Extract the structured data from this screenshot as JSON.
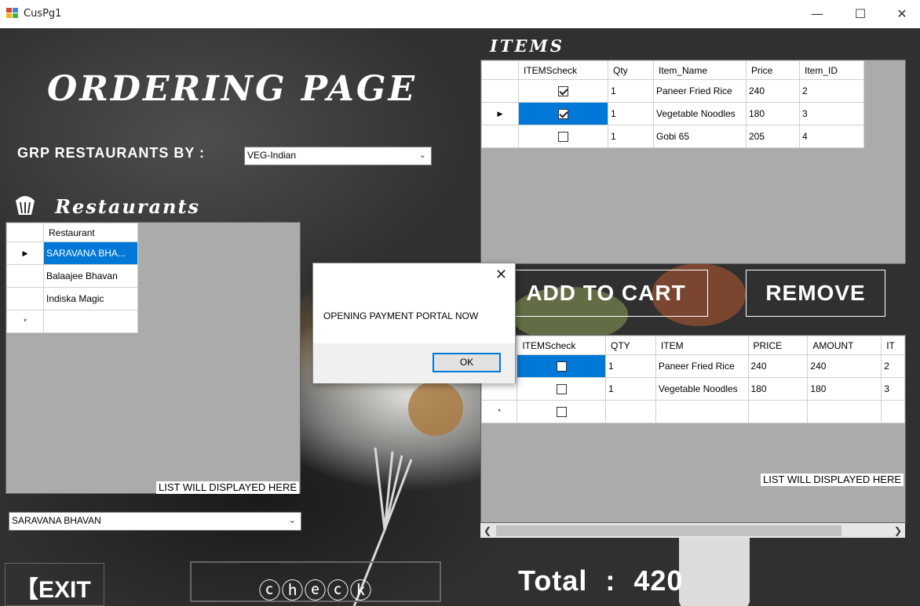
{
  "window": {
    "title": "CusPg1",
    "minimize": "—",
    "maximize": "☐",
    "close": "✕"
  },
  "headings": {
    "ordering": "ORDERING PAGE",
    "items": "ITEMS",
    "restaurants": "Restaurants"
  },
  "group_by": {
    "label": "GRP RESTAURANTS BY :",
    "value": "VEG-Indian"
  },
  "restaurant_grid": {
    "header": "Restaurant",
    "rows": [
      "SARAVANA BHA...",
      "Balaajee Bhavan",
      "Indiska Magic",
      ""
    ],
    "new_row_marker": "*",
    "list_label": "LIST WILL DISPLAYED HERE"
  },
  "restaurant_select": {
    "value": "SARAVANA BHAVAN"
  },
  "items_grid": {
    "headers": [
      "ITEMScheck",
      "Qty",
      "Item_Name",
      "Price",
      "Item_ID"
    ],
    "rows": [
      {
        "checked": true,
        "qty": "1",
        "name": "Paneer Fried Rice",
        "price": "240",
        "id": "2"
      },
      {
        "checked": true,
        "qty": "1",
        "name": "Vegetable Noodles",
        "price": "180",
        "id": "3"
      },
      {
        "checked": false,
        "qty": "1",
        "name": "Gobi 65",
        "price": "205",
        "id": "4"
      }
    ]
  },
  "buttons": {
    "add_to_cart": "ADD TO CART",
    "remove": "REMOVE",
    "exit": "EXIT",
    "check": "ⓒⓗⓔⓒⓚ"
  },
  "cart_grid": {
    "headers": [
      "ITEMScheck",
      "QTY",
      "ITEM",
      "PRICE",
      "AMOUNT",
      "IT"
    ],
    "rows": [
      {
        "checked": false,
        "qty": "1",
        "item": "Paneer Fried Rice",
        "price": "240",
        "amount": "240",
        "id": "2"
      },
      {
        "checked": false,
        "qty": "1",
        "item": "Vegetable Noodles",
        "price": "180",
        "amount": "180",
        "id": "3"
      }
    ],
    "new_row_marker": "*",
    "list_label": "LIST WILL DISPLAYED HERE"
  },
  "dialog": {
    "message": "OPENING PAYMENT PORTAL NOW",
    "ok": "OK",
    "close": "✕"
  },
  "total": {
    "label": "Total",
    "separator": ":",
    "value": "420"
  }
}
